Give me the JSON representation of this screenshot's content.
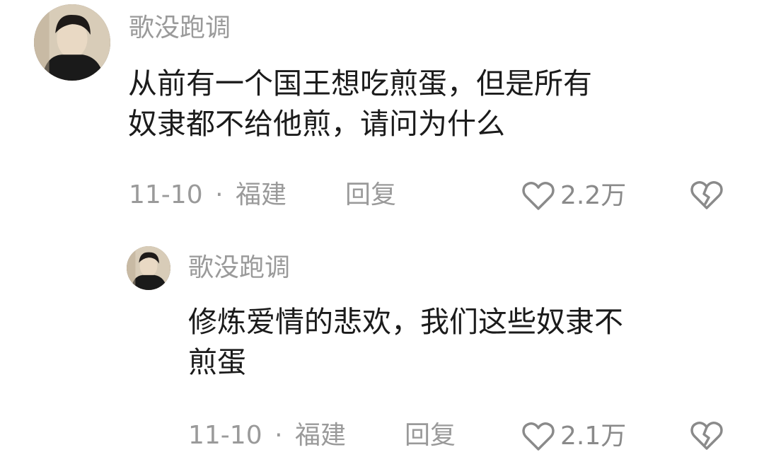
{
  "comments": [
    {
      "username": "歌没跑调",
      "content_line1": "从前有一个国王想吃煎蛋，但是所有",
      "content_line2": "奴隶都不给他煎，请问为什么",
      "date": "11-10",
      "separator": "·",
      "location": "福建",
      "reply_label": "回复",
      "likes": "2.2万"
    },
    {
      "username": "歌没跑调",
      "content_line1": "修炼爱情的悲欢，我们这些奴隶不",
      "content_line2": "煎蛋",
      "date": "11-10",
      "separator": "·",
      "location": "福建",
      "reply_label": "回复",
      "likes": "2.1万"
    }
  ],
  "icons": {
    "like": "heart-outline-icon",
    "dislike": "broken-heart-icon"
  },
  "colors": {
    "text_primary": "#1b1b1b",
    "text_secondary": "#9a9a9a",
    "background": "#ffffff"
  }
}
